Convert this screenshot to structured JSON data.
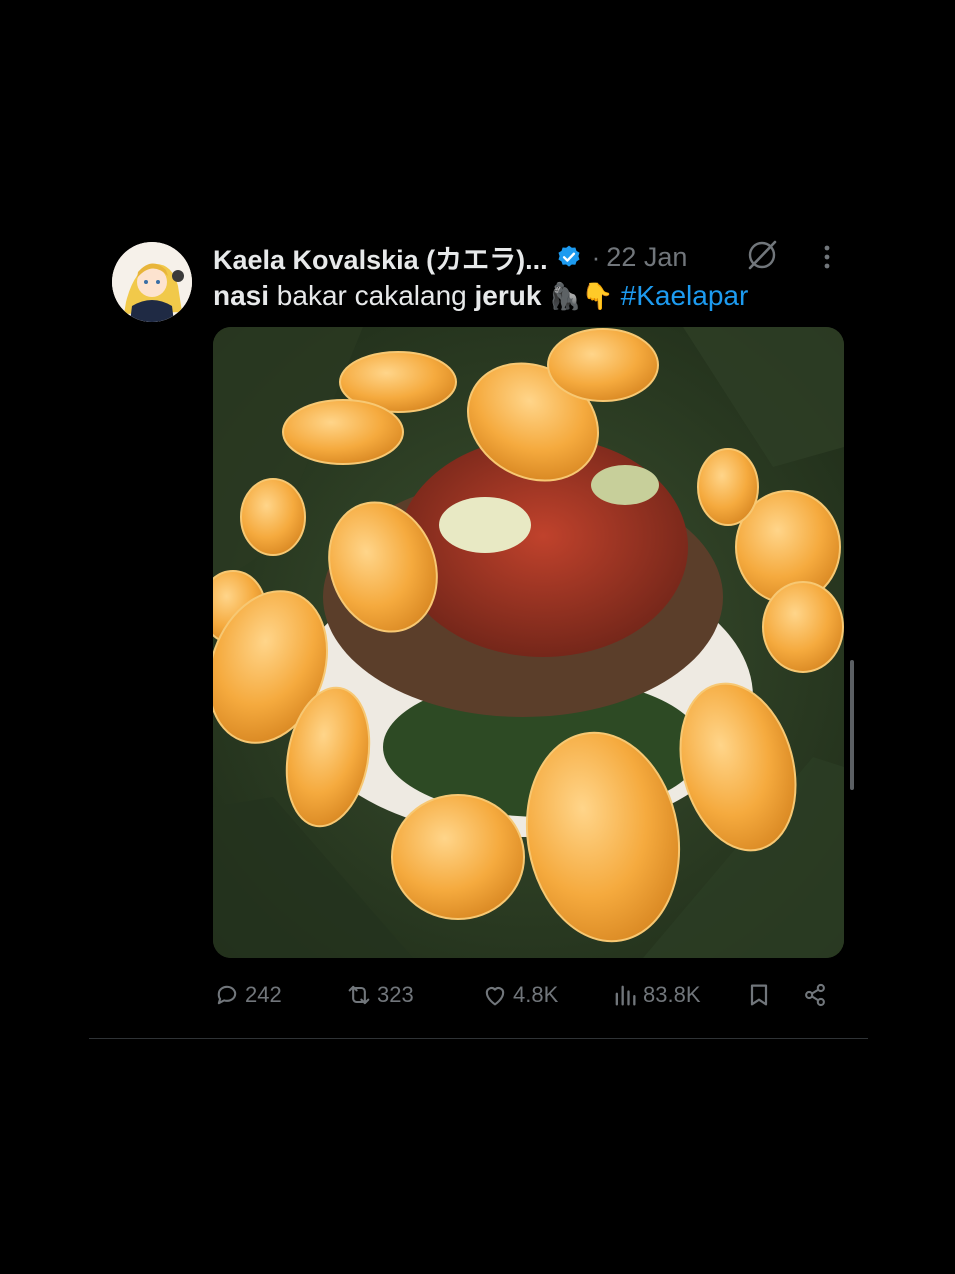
{
  "tweet": {
    "author_name": "Kaela Kovalskia (カエラ)...",
    "date": "22 Jan",
    "text": {
      "word1": "nasi",
      "word2": " bakar cakalang ",
      "word3": "jeruk",
      "emojis": " 🦍👇 ",
      "hashtag": "#Kaelapar"
    }
  },
  "actions": {
    "replies": "242",
    "reposts": "323",
    "likes": "4.8K",
    "views": "83.8K"
  },
  "icons": [
    "verified-badge-icon",
    "grok-icon",
    "more-icon",
    "reply-icon",
    "repost-icon",
    "like-icon",
    "views-icon",
    "bookmark-icon",
    "share-icon"
  ],
  "colors": {
    "background": "#000000",
    "text": "#e7e9ea",
    "muted": "#71767b",
    "accent": "#1d9bf0"
  }
}
